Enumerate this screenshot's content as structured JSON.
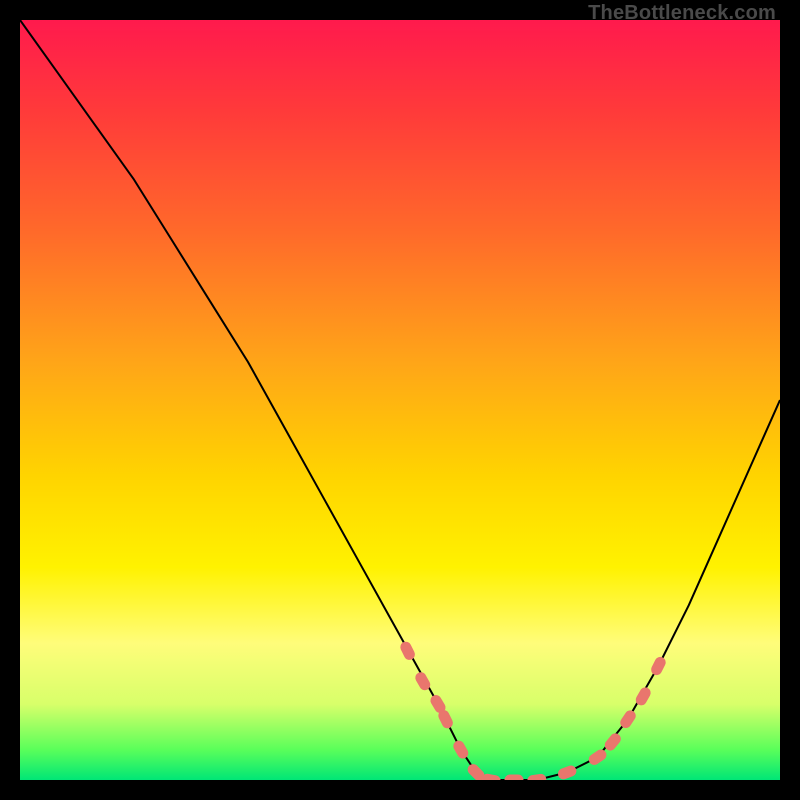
{
  "watermark": "TheBottleneck.com",
  "chart_data": {
    "type": "line",
    "title": "",
    "xlabel": "",
    "ylabel": "",
    "xlim": [
      0,
      100
    ],
    "ylim": [
      0,
      100
    ],
    "series": [
      {
        "name": "bottleneck-curve",
        "x": [
          0,
          5,
          10,
          15,
          20,
          25,
          30,
          35,
          40,
          45,
          50,
          55,
          58,
          60,
          62,
          64,
          68,
          72,
          76,
          80,
          84,
          88,
          92,
          96,
          100
        ],
        "y": [
          100,
          93,
          86,
          79,
          71,
          63,
          55,
          46,
          37,
          28,
          19,
          10,
          4,
          1,
          0,
          0,
          0,
          1,
          3,
          8,
          15,
          23,
          32,
          41,
          50
        ]
      }
    ],
    "markers": {
      "name": "highlight-points",
      "color": "#e9766d",
      "x": [
        51,
        53,
        55,
        56,
        58,
        60,
        62,
        65,
        68,
        72,
        76,
        78,
        80,
        82,
        84
      ],
      "y": [
        17,
        13,
        10,
        8,
        4,
        1,
        0,
        0,
        0,
        1,
        3,
        5,
        8,
        11,
        15
      ]
    }
  }
}
